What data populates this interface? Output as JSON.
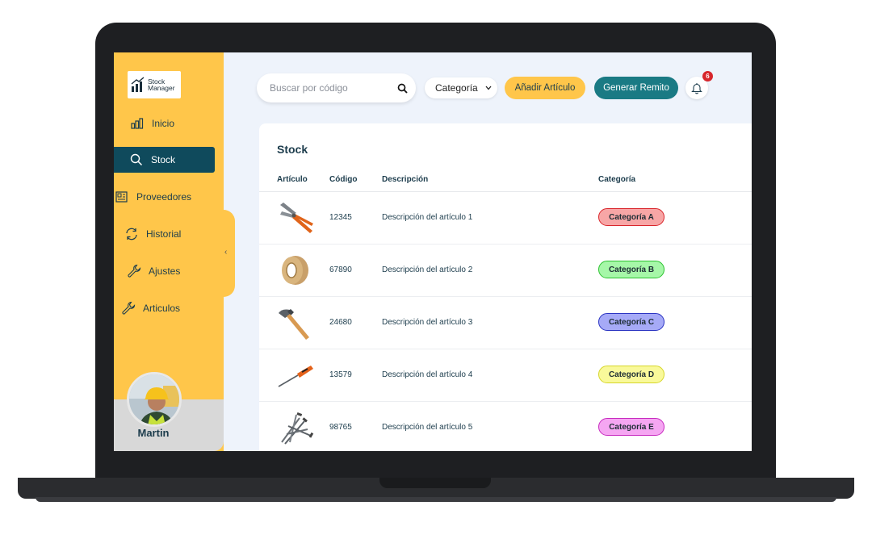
{
  "app": {
    "logo_line1": "Stock",
    "logo_line2": "Manager"
  },
  "sidebar": {
    "items": [
      {
        "label": "Inicio",
        "icon": "bar-chart-icon"
      },
      {
        "label": "Stock",
        "icon": "search-icon",
        "active": true
      },
      {
        "label": "Proveedores",
        "icon": "newspaper-icon"
      },
      {
        "label": "Historial",
        "icon": "refresh-icon"
      },
      {
        "label": "Ajustes",
        "icon": "wrench-icon"
      },
      {
        "label": "Articulos",
        "icon": "wrench-icon"
      }
    ],
    "user_name": "Martin"
  },
  "topbar": {
    "search_placeholder": "Buscar por código",
    "category_label": "Categoría",
    "add_label": "Añadir Artículo",
    "remito_label": "Generar Remito",
    "notification_count": "6"
  },
  "table": {
    "title": "Stock",
    "columns": [
      "Artículo",
      "Código",
      "Descripción",
      "Categoría"
    ],
    "rows": [
      {
        "image": "pliers-icon",
        "code": "12345",
        "description": "Descripción del artículo 1",
        "category": "Categoría A",
        "color": "#f7a6a6",
        "border": "#d9262c"
      },
      {
        "image": "tape-roll-icon",
        "code": "67890",
        "description": "Descripción del artículo 2",
        "category": "Categoría B",
        "color": "#a6f7a8",
        "border": "#2bc22f"
      },
      {
        "image": "hammer-icon",
        "code": "24680",
        "description": "Descripción del artículo 3",
        "category": "Categoría C",
        "color": "#a6aaf7",
        "border": "#2b34c2"
      },
      {
        "image": "screwdriver-icon",
        "code": "13579",
        "description": "Descripción del artículo 4",
        "category": "Categoría D",
        "color": "#f9f99a",
        "border": "#d6d62a"
      },
      {
        "image": "nails-icon",
        "code": "98765",
        "description": "Descripción del artículo 5",
        "category": "Categoría E",
        "color": "#f5a6f2",
        "border": "#c72bbf"
      }
    ]
  }
}
